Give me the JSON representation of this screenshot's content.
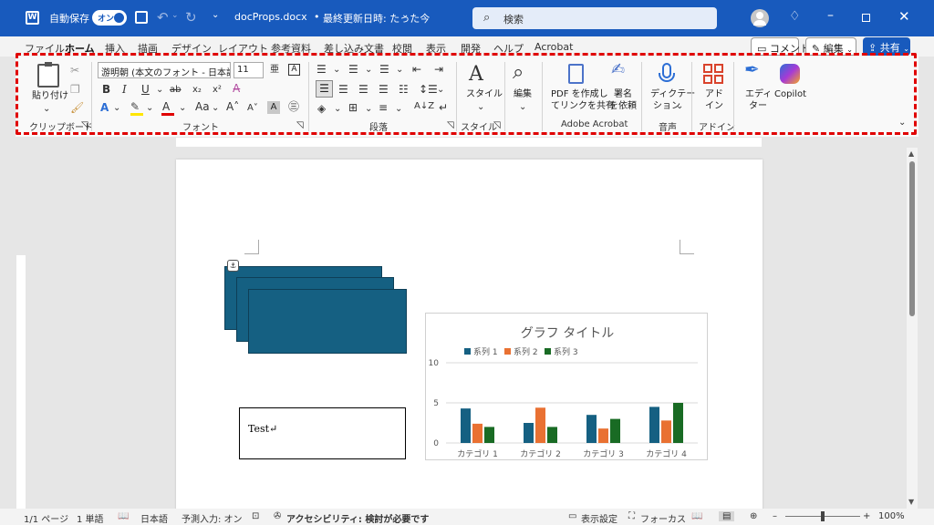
{
  "titlebar": {
    "autosave_label": "自動保存",
    "autosave_state": "オン",
    "doc_name": "docProps.docx",
    "dot": "•",
    "last_saved": "最終更新日時: たった今",
    "search_placeholder": "検索"
  },
  "menu": {
    "items": [
      "ファイル",
      "ホーム",
      "挿入",
      "描画",
      "デザイン",
      "レイアウト",
      "参考資料",
      "差し込み文書",
      "校閲",
      "表示",
      "開発",
      "ヘルプ",
      "Acrobat"
    ],
    "active": "ホーム",
    "comment_label": "コメント",
    "edit_label": "編集",
    "share_label": "共有"
  },
  "ribbon": {
    "clipboard": {
      "paste_label": "貼り付け",
      "group_label": "クリップボード"
    },
    "font": {
      "font_name": "游明朝 (本文のフォント - 日本語)",
      "font_size": "11",
      "bold": "B",
      "italic": "I",
      "underline": "U",
      "strike": "ab",
      "sub": "x₂",
      "sup": "x²",
      "group_label": "フォント"
    },
    "paragraph": {
      "group_label": "段落"
    },
    "styles": {
      "styles_label": "スタイル",
      "group_label": "スタイル"
    },
    "editing": {
      "edit_label": "編集"
    },
    "acrobat": {
      "pdf_line1": "PDF を作成し",
      "pdf_line2": "てリンクを共有",
      "sign_line1": "署名",
      "sign_line2": "を依頼",
      "group_label": "Adobe Acrobat"
    },
    "voice": {
      "dictate_line1": "ディクテー",
      "dictate_line2": "ション",
      "group_label": "音声"
    },
    "addins": {
      "addin_line1": "アド",
      "addin_line2": "イン",
      "group_label": "アドイン"
    },
    "editor": {
      "line1": "エディ",
      "line2": "ター"
    },
    "copilot": {
      "label": "Copilot"
    }
  },
  "document": {
    "textbox_text": "Test↵"
  },
  "chart_data": {
    "type": "bar",
    "title": "グラフ タイトル",
    "categories": [
      "カテゴリ 1",
      "カテゴリ 2",
      "カテゴリ 3",
      "カテゴリ 4"
    ],
    "series": [
      {
        "name": "系列 1",
        "values": [
          4.3,
          2.5,
          3.5,
          4.5
        ],
        "color": "#156082"
      },
      {
        "name": "系列 2",
        "values": [
          2.4,
          4.4,
          1.8,
          2.8
        ],
        "color": "#e97132"
      },
      {
        "name": "系列 3",
        "values": [
          2.0,
          2.0,
          3.0,
          5.0
        ],
        "color": "#196b24"
      }
    ],
    "ylim": [
      0,
      10
    ],
    "yticks": [
      "0",
      "5",
      "10"
    ],
    "legend": "top",
    "grid": true
  },
  "statusbar": {
    "page": "1/1 ページ",
    "words": "1 単語",
    "lang": "日本語",
    "predict": "予測入力: オン",
    "accessibility": "アクセシビリティ: 検討が必要です",
    "display_settings": "表示設定",
    "focus": "フォーカス",
    "zoom": "100%"
  },
  "colors": {
    "accent": "#185abd",
    "shape_fill": "#156082",
    "ribbon_highlight": "#e00000"
  }
}
